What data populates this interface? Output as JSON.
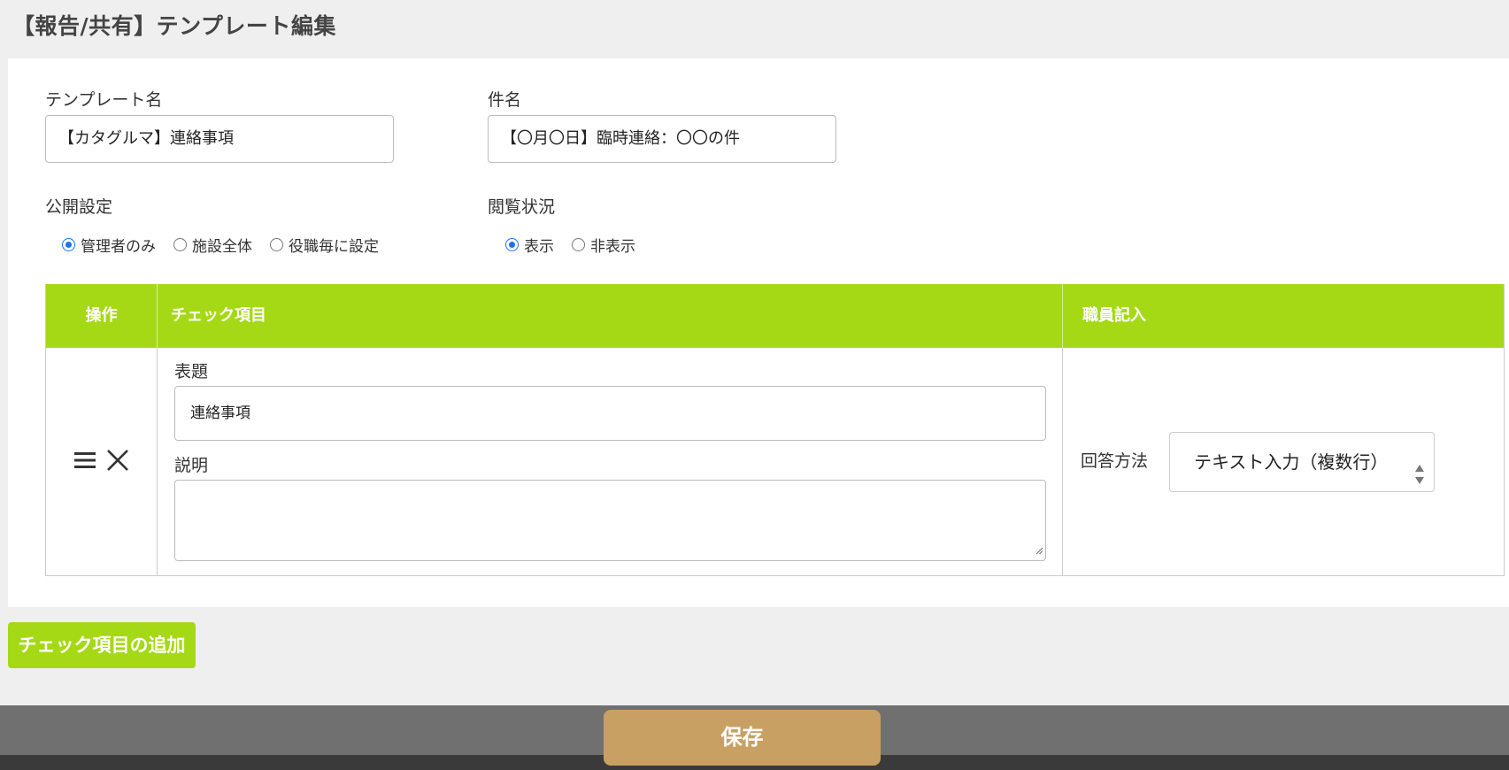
{
  "page": {
    "title": "【報告/共有】テンプレート編集"
  },
  "form": {
    "template_name": {
      "label": "テンプレート名",
      "value": "【カタグルマ】連絡事項"
    },
    "subject": {
      "label": "件名",
      "value": "【〇月〇日】臨時連絡：〇〇の件"
    },
    "visibility": {
      "label": "公開設定",
      "options": [
        "管理者のみ",
        "施設全体",
        "役職毎に設定"
      ],
      "selected": "管理者のみ"
    },
    "read_status": {
      "label": "閲覧状況",
      "options": [
        "表示",
        "非表示"
      ],
      "selected": "表示"
    }
  },
  "table": {
    "headers": {
      "operation": "操作",
      "check_item": "チェック項目",
      "staff_entry": "職員記入"
    },
    "rows": [
      {
        "title_label": "表題",
        "title_value": "連絡事項",
        "description_label": "説明",
        "description_value": "",
        "answer_label": "回答方法",
        "answer_value": "テキスト入力（複数行）",
        "icons": [
          "drag-handle-icon",
          "delete-x-icon"
        ]
      }
    ]
  },
  "actions": {
    "add_label": "チェック項目の追加",
    "save_label": "保存"
  },
  "colors": {
    "accent_green": "#a5d916",
    "save_gold": "#c9a063",
    "radio_blue": "#1a73e8",
    "background": "#efefef",
    "footer": "#707070"
  }
}
